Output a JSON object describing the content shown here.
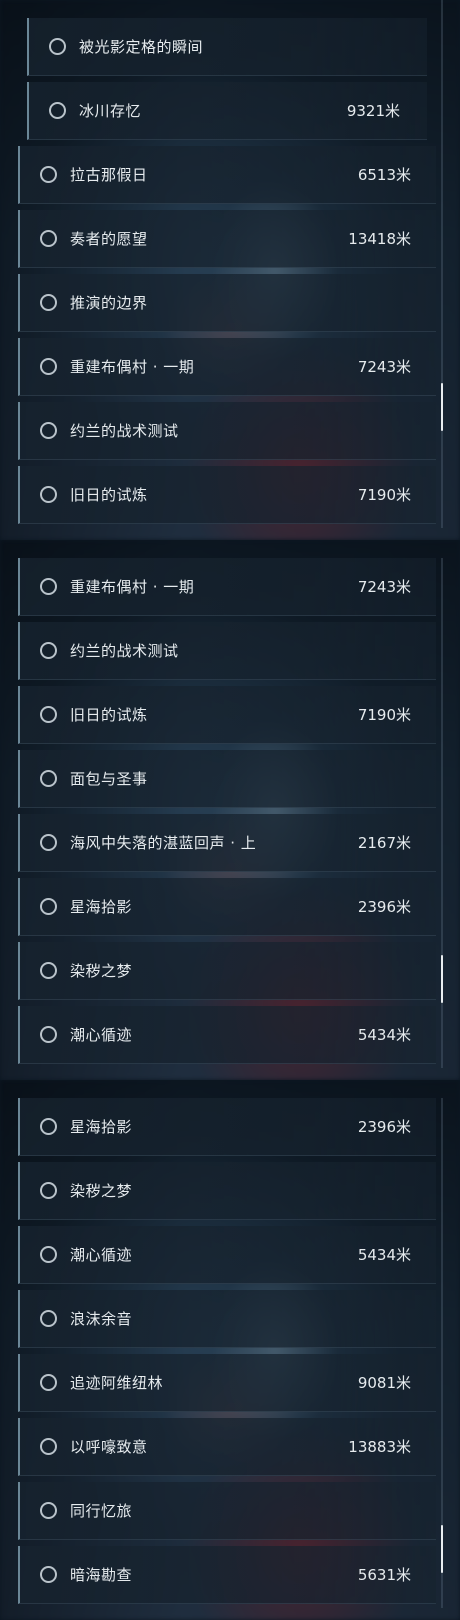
{
  "panels": [
    {
      "items": [
        {
          "name": "被光影定格的瞬间",
          "distance": "",
          "indented": true
        },
        {
          "name": "冰川存忆",
          "distance": "9321米",
          "indented": true
        },
        {
          "name": "拉古那假日",
          "distance": "6513米"
        },
        {
          "name": "奏者的愿望",
          "distance": "13418米"
        },
        {
          "name": "推演的边界",
          "distance": ""
        },
        {
          "name": "重建布偶村 · 一期",
          "distance": "7243米"
        },
        {
          "name": "约兰的战术测试",
          "distance": ""
        },
        {
          "name": "旧日的试炼",
          "distance": "7190米"
        }
      ]
    },
    {
      "items": [
        {
          "name": "重建布偶村 · 一期",
          "distance": "7243米"
        },
        {
          "name": "约兰的战术测试",
          "distance": ""
        },
        {
          "name": "旧日的试炼",
          "distance": "7190米"
        },
        {
          "name": "面包与圣事",
          "distance": ""
        },
        {
          "name": "海风中失落的湛蓝回声 · 上",
          "distance": "2167米"
        },
        {
          "name": "星海拾影",
          "distance": "2396米"
        },
        {
          "name": "染秽之梦",
          "distance": ""
        },
        {
          "name": "潮心循迹",
          "distance": "5434米"
        }
      ]
    },
    {
      "items": [
        {
          "name": "星海拾影",
          "distance": "2396米"
        },
        {
          "name": "染秽之梦",
          "distance": ""
        },
        {
          "name": "潮心循迹",
          "distance": "5434米"
        },
        {
          "name": "浪沫余音",
          "distance": ""
        },
        {
          "name": "追迹阿维纽林",
          "distance": "9081米"
        },
        {
          "name": "以呼嚎致意",
          "distance": "13883米"
        },
        {
          "name": "同行忆旅",
          "distance": ""
        },
        {
          "name": "暗海勘查",
          "distance": "5631米"
        }
      ]
    }
  ]
}
